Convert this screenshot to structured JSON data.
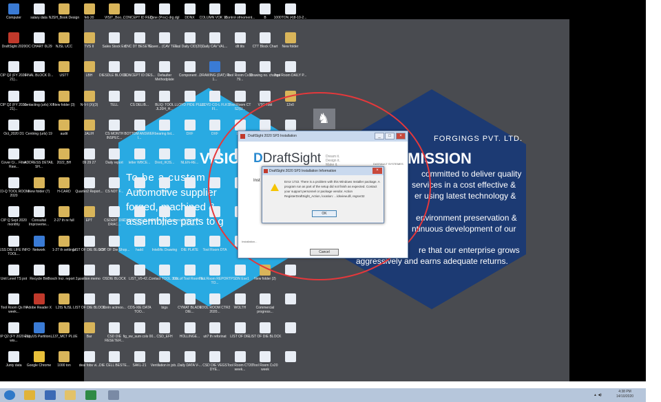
{
  "desktop": {
    "icons": [
      {
        "label": "Computer",
        "color": "#3a7bd5"
      },
      {
        "label": "salary data",
        "color": "#e9eef5"
      },
      {
        "label": "NJSH_Book Design",
        "color": "#d9b55a"
      },
      {
        "label": "feb 20",
        "color": "#d9b55a"
      },
      {
        "label": "VISIT_Boo...",
        "color": "#d9b55a"
      },
      {
        "label": "CONCEPT ID REQ...",
        "color": "#e9eef5"
      },
      {
        "label": "Zone (Proc) drg.dgl",
        "color": "#e9eef5"
      },
      {
        "label": "DDNX",
        "color": "#e9eef5"
      },
      {
        "label": "COLUMN VOK 18...",
        "color": "#e9eef5"
      },
      {
        "label": "Control ofmoment...",
        "color": "#e9eef5"
      },
      {
        "label": "B",
        "color": "#e9eef5"
      },
      {
        "label": "1000TON (4)8-10-2...",
        "color": "#e9eef5"
      },
      {
        "label": "DraftSight 2020",
        "color": "#c0392b"
      },
      {
        "label": "OC CHART 0L29",
        "color": "#e9eef5"
      },
      {
        "label": "NJSL UCC",
        "color": "#d9b55a"
      },
      {
        "label": "TVS II",
        "color": "#d9b55a"
      },
      {
        "label": "Sales Stock Ext",
        "color": "#e9eef5"
      },
      {
        "label": "CNC DT BESETE...",
        "color": "#e9eef5"
      },
      {
        "label": "Cover... (CAV TEE...",
        "color": "#e9eef5"
      },
      {
        "label": "Tool Daily CID(20)...",
        "color": "#e9eef5"
      },
      {
        "label": "Daily CAV VAL...",
        "color": "#e9eef5"
      },
      {
        "label": "dlt tits",
        "color": "#e9eef5"
      },
      {
        "label": "CTT Block Chart",
        "color": "#e9eef5"
      },
      {
        "label": "New folder",
        "color": "#d9b55a"
      },
      {
        "label": "CIP Q2 (FY 2020-21)...",
        "color": "#e9eef5"
      },
      {
        "label": "FINAL BLOCK D...",
        "color": "#e9eef5"
      },
      {
        "label": "USTT",
        "color": "#d9b55a"
      },
      {
        "label": "LBH",
        "color": "#d9b55a"
      },
      {
        "label": "DIESDLE BLOCK...",
        "color": "#e9eef5"
      },
      {
        "label": "CONCEPT ID DES...",
        "color": "#e9eef5"
      },
      {
        "label": "Defaulter Methodplate",
        "color": "#e9eef5"
      },
      {
        "label": "Component ...",
        "color": "#e9eef5"
      },
      {
        "label": "DRAWING (DAT) R-1...",
        "color": "#3a7bd5"
      },
      {
        "label": "Tool Room Cv10 79...",
        "color": "#e9eef5"
      },
      {
        "label": "Drawing no. change",
        "color": "#e9eef5"
      },
      {
        "label": "Tool Room DAILY P...",
        "color": "#e9eef5"
      },
      {
        "label": "CIP Q2 (FY 2020-21)...",
        "color": "#e9eef5"
      },
      {
        "label": "contacting (urls) XII",
        "color": "#e9eef5"
      },
      {
        "label": "New folder (3)",
        "color": "#d9b55a"
      },
      {
        "label": "N-V-I (X)(3)",
        "color": "#d9b55a"
      },
      {
        "label": "TELL",
        "color": "#e9eef5"
      },
      {
        "label": "CS DELIB...",
        "color": "#e9eef5"
      },
      {
        "label": "BLIQ: TOOL JL20H_H...",
        "color": "#e9eef5"
      },
      {
        "label": "LLOYD PIDE PLUS",
        "color": "#e9eef5"
      },
      {
        "label": "LLOYD CO-L FLKS FI...",
        "color": "#e9eef5"
      },
      {
        "label": "Tool Room CT S2(U...",
        "color": "#e9eef5"
      },
      {
        "label": "VTG Tool",
        "color": "#e9eef5"
      },
      {
        "label": "12v0",
        "color": "#d9b55a"
      },
      {
        "label": "Oct_2020 D1",
        "color": "#e9eef5"
      },
      {
        "label": "Centring (urls) 19",
        "color": "#e9eef5"
      },
      {
        "label": "audit",
        "color": "#d9b55a"
      },
      {
        "label": "JALIH",
        "color": "#d9b55a"
      },
      {
        "label": "CS MONTH INSPEC...",
        "color": "#e9eef5"
      },
      {
        "label": "BOTTOM ANSWER I...",
        "color": "#e9eef5"
      },
      {
        "label": "bearing list...",
        "color": "#e9eef5"
      },
      {
        "label": "DXF",
        "color": "#e9eef5"
      },
      {
        "label": "DXF",
        "color": "#e9eef5"
      },
      {
        "label": "DXF",
        "color": "#e9eef5"
      },
      {
        "label": "",
        "color": "#e9eef5"
      },
      {
        "label": "",
        "color": "#e9eef5"
      },
      {
        "label": "Cover Cr... Filter Raw...",
        "color": "#e9eef5"
      },
      {
        "label": "ADDRESS DETAIL SH...",
        "color": "#e9eef5"
      },
      {
        "label": "2022_BH",
        "color": "#d9b55a"
      },
      {
        "label": "09 29 27",
        "color": "#e9eef5"
      },
      {
        "label": "Daily report",
        "color": "#e9eef5"
      },
      {
        "label": "letter WBCE...",
        "color": "#e9eef5"
      },
      {
        "label": "Dnrd_IK3S...",
        "color": "#e9eef5"
      },
      {
        "label": "NLEN-RE...",
        "color": "#e9eef5"
      },
      {
        "label": "",
        "color": "#e9eef5"
      },
      {
        "label": "",
        "color": "#e9eef5"
      },
      {
        "label": "",
        "color": "#e9eef5"
      },
      {
        "label": "",
        "color": "#e9eef5"
      },
      {
        "label": "CO-Q TOOL ROOM 2020",
        "color": "#e9eef5"
      },
      {
        "label": "New folder (7)",
        "color": "#d9b55a"
      },
      {
        "label": "H-CARD",
        "color": "#d9b55a"
      },
      {
        "label": "Quarter2 Report...",
        "color": "#e9eef5"
      },
      {
        "label": "CS NDT F...",
        "color": "#e9eef5"
      },
      {
        "label": "DWG",
        "color": "#e9eef5"
      },
      {
        "label": "DWG",
        "color": "#e9eef5"
      },
      {
        "label": "",
        "color": "#e9eef5"
      },
      {
        "label": "",
        "color": "#e9eef5"
      },
      {
        "label": "",
        "color": "#e9eef5"
      },
      {
        "label": "",
        "color": "#e9eef5"
      },
      {
        "label": "",
        "color": "#e9eef5"
      },
      {
        "label": "CIP Q Sept 2020 monthly",
        "color": "#e9eef5"
      },
      {
        "label": "Consultal Improveme...",
        "color": "#e9eef5"
      },
      {
        "label": "2-27 th re full",
        "color": "#d9b55a"
      },
      {
        "label": "EPT",
        "color": "#d9b55a"
      },
      {
        "label": "CSDEBT DIE DRAC...",
        "color": "#e9eef5"
      },
      {
        "label": "CSDBOTTO BLOCK DR...",
        "color": "#e9eef5"
      },
      {
        "label": "UPPER DIE Bottom p...",
        "color": "#e9eef5"
      },
      {
        "label": "LOWER DIE C0.lo.ub...",
        "color": "#e9eef5"
      },
      {
        "label": "",
        "color": "#e9eef5"
      },
      {
        "label": "",
        "color": "#e9eef5"
      },
      {
        "label": "",
        "color": "#e9eef5"
      },
      {
        "label": "",
        "color": "#e9eef5"
      },
      {
        "label": "LESS DIE LIFE INFO TOOL...",
        "color": "#e9eef5"
      },
      {
        "label": "Network",
        "color": "#3a7bd5"
      },
      {
        "label": "1-27 th settings",
        "color": "#d9b55a"
      },
      {
        "label": "LIST OF DIE BLOCK",
        "color": "#e9eef5"
      },
      {
        "label": "LIST OF Die Shop...",
        "color": "#e9eef5"
      },
      {
        "label": "hadd",
        "color": "#e9eef5"
      },
      {
        "label": "Intellific Drawing",
        "color": "#e9eef5"
      },
      {
        "label": "DIE PLATE",
        "color": "#e9eef5"
      },
      {
        "label": "Tool Room DTA",
        "color": "#e9eef5"
      },
      {
        "label": "",
        "color": "#e9eef5"
      },
      {
        "label": "",
        "color": "#e9eef5"
      },
      {
        "label": "",
        "color": "#e9eef5"
      },
      {
        "label": "Unit Level TS pot",
        "color": "#e9eef5"
      },
      {
        "label": "Recycle Bin",
        "color": "#e9eef5"
      },
      {
        "label": "Bosch Incr. report 2...",
        "color": "#e9eef5"
      },
      {
        "label": "position memo",
        "color": "#e9eef5"
      },
      {
        "label": "OSDIE BLOCK",
        "color": "#e9eef5"
      },
      {
        "label": "LIST_V0-42...",
        "color": "#e9eef5"
      },
      {
        "label": "Contact TOOL 300...",
        "color": "#e9eef5"
      },
      {
        "label": "List of Tool Room E...",
        "color": "#e9eef5"
      },
      {
        "label": "Tool Room REPORT TO...",
        "color": "#e9eef5"
      },
      {
        "label": "PSDN Exe1",
        "color": "#e9eef5"
      },
      {
        "label": "New folder (2)",
        "color": "#d9b55a"
      },
      {
        "label": "",
        "color": "#e9eef5"
      },
      {
        "label": "Tool Room Qs IN week...",
        "color": "#e9eef5"
      },
      {
        "label": "Adobe Reader X",
        "color": "#c0392b"
      },
      {
        "label": "L2IS NJSL",
        "color": "#d9b55a"
      },
      {
        "label": "LIST OF DIE BLOCK",
        "color": "#e9eef5"
      },
      {
        "label": "Cnrin actmoo...",
        "color": "#e9eef5"
      },
      {
        "label": "CDS-XIE DATA TOO...",
        "color": "#e9eef5"
      },
      {
        "label": "bigs",
        "color": "#e9eef5"
      },
      {
        "label": "CYMAT BLADE DIE...",
        "color": "#e9eef5"
      },
      {
        "label": "TOOL ROOM CTR2 2020...",
        "color": "#e9eef5"
      },
      {
        "label": "WOLTH",
        "color": "#e9eef5"
      },
      {
        "label": "Commercial progress...",
        "color": "#e9eef5"
      },
      {
        "label": "",
        "color": "#e9eef5"
      },
      {
        "label": "CIP Q2 (FY 2020-21) wis...",
        "color": "#e9eef5"
      },
      {
        "label": "EasyUS Partition...",
        "color": "#3a7bd5"
      },
      {
        "label": "L137_MCT PLUE",
        "color": "#d9b55a"
      },
      {
        "label": "Bar",
        "color": "#d9b55a"
      },
      {
        "label": "CSD DIE RESETER...",
        "color": "#e9eef5"
      },
      {
        "label": "fig_sw_sum cols 00...",
        "color": "#e9eef5"
      },
      {
        "label": "CSD_EFH",
        "color": "#e9eef5"
      },
      {
        "label": "HOLLINGE...",
        "color": "#e9eef5"
      },
      {
        "label": "uti7 th reforinat",
        "color": "#e9eef5"
      },
      {
        "label": "LIST OF DIE",
        "color": "#e9eef5"
      },
      {
        "label": "LIST OF DIE BLOCK",
        "color": "#e9eef5"
      },
      {
        "label": "",
        "color": "#e9eef5"
      },
      {
        "label": "Junty data",
        "color": "#e9eef5"
      },
      {
        "label": "Google Chrome",
        "color": "#e9c03a"
      },
      {
        "label": "1000 ton",
        "color": "#d9b55a"
      },
      {
        "label": "deal fobs vi...",
        "color": "#e9eef5"
      },
      {
        "label": "DIE CELL BESTE...",
        "color": "#e9eef5"
      },
      {
        "label": "SAKL-21",
        "color": "#e9eef5"
      },
      {
        "label": "Ventilation in job...",
        "color": "#e9eef5"
      },
      {
        "label": "Daily DATA V-...",
        "color": "#e9eef5"
      },
      {
        "label": "CSD DIE VEGS DYE...",
        "color": "#e9eef5"
      },
      {
        "label": "Tool Room CT20 week...",
        "color": "#e9eef5"
      },
      {
        "label": "Tool Room Cv20 week",
        "color": "#e9eef5"
      },
      {
        "label": "",
        "color": "#e9eef5"
      }
    ]
  },
  "wallpaper": {
    "company": "FORGINGS PVT. LTD.",
    "vision_title": "VISION",
    "vision_lines": [
      "To be a custom",
      "Automotive supplier",
      "forged, machined &",
      "assemblies parts to g"
    ],
    "mission_title": "MISSION",
    "mission_lines": [
      "committed to deliver quality",
      "services in a cost effective &",
      "er using latest technology &",
      "environment preservation &",
      "ntinuous development of our",
      "re that our enterprise grows",
      "aggressively and earns adequate returns."
    ]
  },
  "installer": {
    "title": "DraftSight 2020 SP3 Installation",
    "logo": "DraftSight",
    "tagline": "Dream it.\nDesign it.\nMake it.",
    "brand": "DASSAULT SYSTEMES",
    "body_text": "Inst",
    "status": "Installation...",
    "cancel": "Cancel",
    "minimize": "_",
    "maximize": "□",
    "close": "×"
  },
  "error_dialog": {
    "title": "DraftSight 2020 SP3 Installation Information",
    "message": "Error 1722. There is a problem with this Windows Installer package. A program run as part of the setup did not finish as expected. Contact your support personnel or package vendor. Action RegisterDraftSight_Action, location: ...\\dsview.dll, regsvr32",
    "ok": "OK",
    "close": "×"
  },
  "taskbar": {
    "time": "4:38 PM",
    "date": "14/10/2020",
    "tray": "▲ ◀)",
    "apps": [
      {
        "name": "start-button",
        "color": "#2f79c8"
      },
      {
        "name": "chrome",
        "color": "#e0b33a"
      },
      {
        "name": "word",
        "color": "#3c6ab5"
      },
      {
        "name": "explorer",
        "color": "#e2c26a"
      },
      {
        "name": "excel",
        "color": "#2f8a45"
      },
      {
        "name": "installer",
        "color": "#7a8aa5"
      }
    ]
  }
}
